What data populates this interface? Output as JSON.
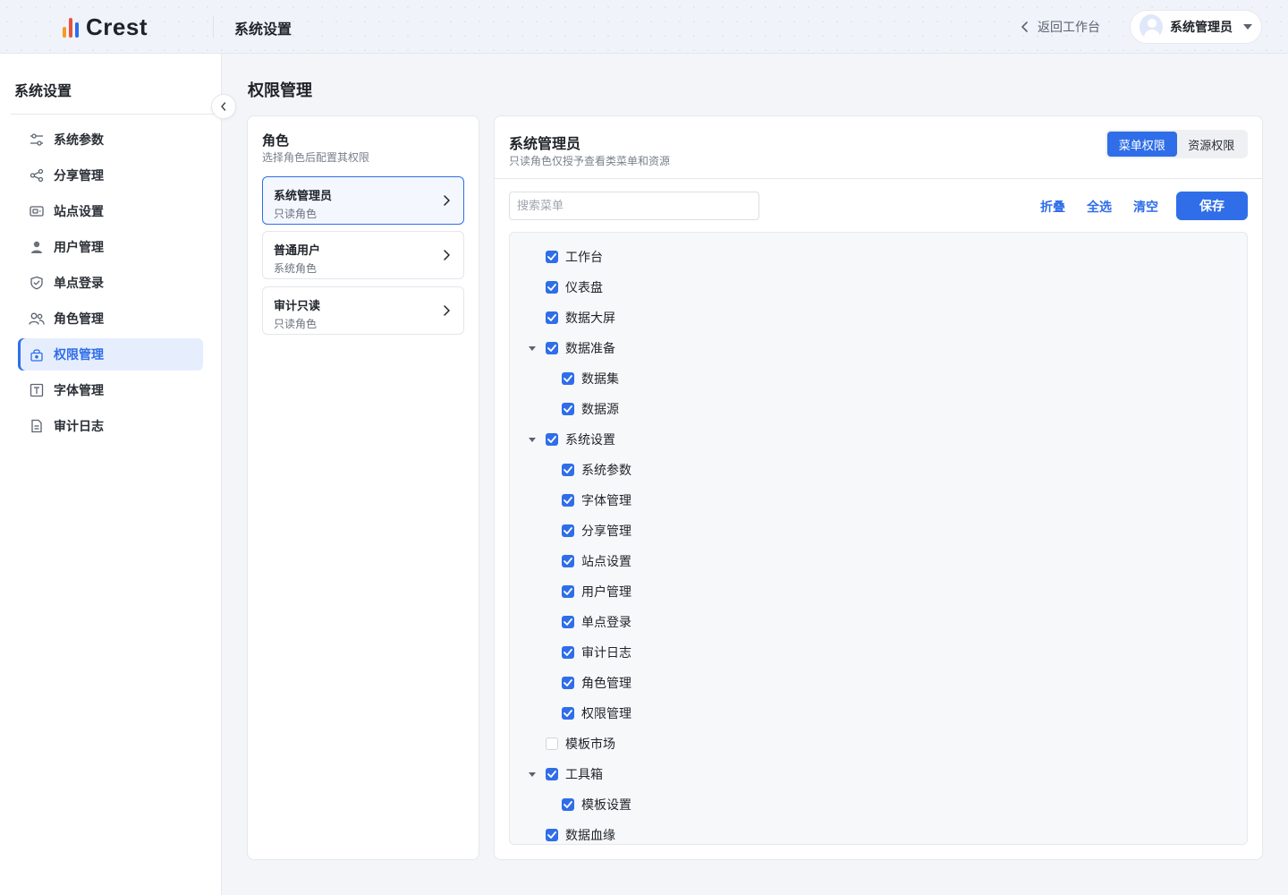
{
  "header": {
    "logo_text": "Crest",
    "title": "系统设置",
    "back_label": "返回工作台",
    "user_name": "系统管理员",
    "brand_colors": [
      "#f59a23",
      "#e8533c",
      "#2f6ee8"
    ]
  },
  "sidebar": {
    "title": "系统设置",
    "items": [
      {
        "label": "系统参数",
        "icon": "sliders-icon",
        "active": false
      },
      {
        "label": "分享管理",
        "icon": "share-icon",
        "active": false
      },
      {
        "label": "站点设置",
        "icon": "site-icon",
        "active": false
      },
      {
        "label": "用户管理",
        "icon": "user-icon",
        "active": false
      },
      {
        "label": "单点登录",
        "icon": "shield-icon",
        "active": false
      },
      {
        "label": "角色管理",
        "icon": "users-icon",
        "active": false
      },
      {
        "label": "权限管理",
        "icon": "lock-icon",
        "active": true
      },
      {
        "label": "字体管理",
        "icon": "font-icon",
        "active": false
      },
      {
        "label": "审计日志",
        "icon": "document-icon",
        "active": false
      }
    ]
  },
  "main": {
    "page_title": "权限管理",
    "roles": {
      "title": "角色",
      "subtitle": "选择角色后配置其权限",
      "items": [
        {
          "name": "系统管理员",
          "type": "只读角色",
          "active": true
        },
        {
          "name": "普通用户",
          "type": "系统角色",
          "active": false
        },
        {
          "name": "审计只读",
          "type": "只读角色",
          "active": false
        }
      ]
    },
    "permissions": {
      "title": "系统管理员",
      "subtitle": "只读角色仅授予查看类菜单和资源",
      "tabs": [
        {
          "label": "菜单权限",
          "active": true
        },
        {
          "label": "资源权限",
          "active": false
        }
      ],
      "search_placeholder": "搜索菜单",
      "actions": {
        "collapse": "折叠",
        "select_all": "全选",
        "clear": "清空",
        "save": "保存"
      },
      "tree": [
        {
          "label": "工作台",
          "level": 0,
          "checked": true,
          "expandable": false
        },
        {
          "label": "仪表盘",
          "level": 0,
          "checked": true,
          "expandable": false
        },
        {
          "label": "数据大屏",
          "level": 0,
          "checked": true,
          "expandable": false
        },
        {
          "label": "数据准备",
          "level": 0,
          "checked": true,
          "expandable": true
        },
        {
          "label": "数据集",
          "level": 1,
          "checked": true,
          "expandable": false
        },
        {
          "label": "数据源",
          "level": 1,
          "checked": true,
          "expandable": false
        },
        {
          "label": "系统设置",
          "level": 0,
          "checked": true,
          "expandable": true
        },
        {
          "label": "系统参数",
          "level": 1,
          "checked": true,
          "expandable": false
        },
        {
          "label": "字体管理",
          "level": 1,
          "checked": true,
          "expandable": false
        },
        {
          "label": "分享管理",
          "level": 1,
          "checked": true,
          "expandable": false
        },
        {
          "label": "站点设置",
          "level": 1,
          "checked": true,
          "expandable": false
        },
        {
          "label": "用户管理",
          "level": 1,
          "checked": true,
          "expandable": false
        },
        {
          "label": "单点登录",
          "level": 1,
          "checked": true,
          "expandable": false
        },
        {
          "label": "审计日志",
          "level": 1,
          "checked": true,
          "expandable": false
        },
        {
          "label": "角色管理",
          "level": 1,
          "checked": true,
          "expandable": false
        },
        {
          "label": "权限管理",
          "level": 1,
          "checked": true,
          "expandable": false
        },
        {
          "label": "模板市场",
          "level": 0,
          "checked": false,
          "expandable": false
        },
        {
          "label": "工具箱",
          "level": 0,
          "checked": true,
          "expandable": true
        },
        {
          "label": "模板设置",
          "level": 1,
          "checked": true,
          "expandable": false
        },
        {
          "label": "数据血缘",
          "level": 0,
          "checked": true,
          "expandable": false
        }
      ]
    }
  },
  "colors": {
    "accent": "#2f6ee8",
    "active_bg": "#e6eefe"
  }
}
